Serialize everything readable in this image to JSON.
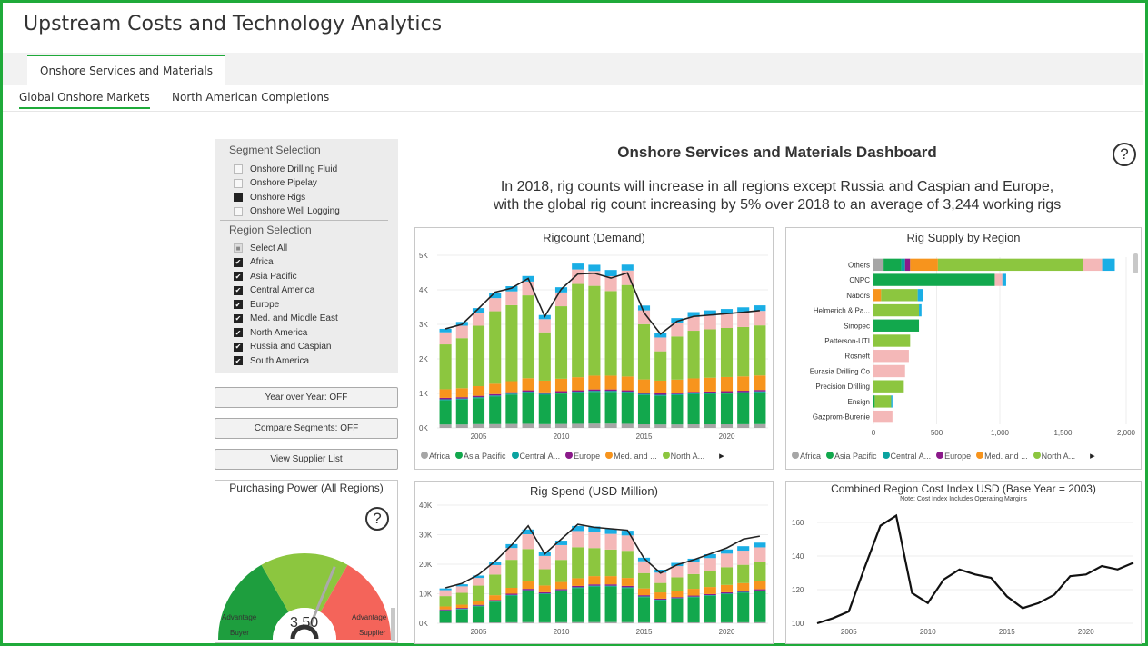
{
  "app": {
    "title": "Upstream Costs and Technology Analytics"
  },
  "tabs": {
    "main": "Onshore Services and Materials",
    "sub": [
      "Global Onshore Markets",
      "North American Completions"
    ]
  },
  "segment_selection": {
    "title": "Segment Selection",
    "items": [
      {
        "label": "Onshore Drilling Fluid",
        "checked": false
      },
      {
        "label": "Onshore Pipelay",
        "checked": false
      },
      {
        "label": "Onshore Rigs",
        "checked": true
      },
      {
        "label": "Onshore Well Logging",
        "checked": false
      }
    ]
  },
  "region_selection": {
    "title": "Region Selection",
    "items": [
      {
        "label": "Select All",
        "checked": "partial"
      },
      {
        "label": "Africa",
        "checked": true
      },
      {
        "label": "Asia Pacific",
        "checked": true
      },
      {
        "label": "Central America",
        "checked": true
      },
      {
        "label": "Europe",
        "checked": true
      },
      {
        "label": "Med. and Middle East",
        "checked": true
      },
      {
        "label": "North America",
        "checked": true
      },
      {
        "label": "Russia and Caspian",
        "checked": true
      },
      {
        "label": "South America",
        "checked": true
      }
    ]
  },
  "buttons": {
    "yoy": "Year over Year: OFF",
    "compare": "Compare Segments: OFF",
    "supplier": "View Supplier List"
  },
  "dashboard": {
    "title": "Onshore Services and Materials Dashboard",
    "headline_1": "In 2018, rig counts will increase in all regions except Russia and Caspian and Europe,",
    "headline_2": "with the global rig count increasing by 5% over 2018 to an average of 3,244 working rigs",
    "help_glyph": "?"
  },
  "colors": {
    "accent": "#1faa3a",
    "africa": "#a6a6a6",
    "asia_pacific": "#12a84d",
    "central_america": "#0aa3a0",
    "europe": "#8b1a8a",
    "med_me": "#f7941d",
    "north_america": "#8cc63f",
    "russia": "#f4b8b8",
    "south_america": "#1aaee5",
    "gauge_left": "#1e9e3e",
    "gauge_mid": "#8cc63f",
    "gauge_right": "#f4645a"
  },
  "legend": {
    "items": [
      "Africa",
      "Asia Pacific",
      "Central A...",
      "Europe",
      "Med. and ...",
      "North A..."
    ],
    "items_supply": [
      "Africa",
      "Asia Pacific",
      "Central A...",
      "Europe",
      "Med. and ...",
      "North A..."
    ],
    "next_icon": "play-right-icon"
  },
  "purchasing_power": {
    "title": "Purchasing Power (All Regions)",
    "value": "3.50",
    "value_num": 3.5,
    "left_label_1": "Advantage",
    "left_label_2": "Buyer",
    "right_label_1": "Advantage",
    "right_label_2": "Supplier"
  },
  "chart_data": [
    {
      "type": "bar",
      "id": "rigcount",
      "title": "Rigcount (Demand)",
      "stacked": true,
      "years": [
        2003,
        2004,
        2005,
        2006,
        2007,
        2008,
        2009,
        2010,
        2011,
        2012,
        2013,
        2014,
        2015,
        2016,
        2017,
        2018,
        2019,
        2020,
        2021,
        2022
      ],
      "ylim": [
        0,
        5000
      ],
      "yticks": [
        0,
        1000,
        2000,
        3000,
        4000,
        5000
      ],
      "ytick_labels": [
        "0K",
        "1K",
        "2K",
        "3K",
        "4K",
        "5K"
      ],
      "xticks": [
        2005,
        2010,
        2015,
        2020
      ],
      "series": [
        {
          "name": "Africa",
          "color": "#a6a6a6",
          "values": [
            100,
            100,
            110,
            110,
            115,
            120,
            110,
            115,
            120,
            125,
            125,
            120,
            105,
            100,
            100,
            105,
            105,
            105,
            108,
            110
          ]
        },
        {
          "name": "Asia Pacific",
          "color": "#12a84d",
          "values": [
            700,
            720,
            750,
            800,
            850,
            900,
            850,
            880,
            900,
            920,
            920,
            900,
            850,
            830,
            850,
            870,
            880,
            890,
            900,
            920
          ]
        },
        {
          "name": "Central America",
          "color": "#0aa3a0",
          "values": [
            30,
            30,
            30,
            30,
            30,
            30,
            30,
            30,
            30,
            30,
            30,
            30,
            30,
            30,
            30,
            30,
            30,
            30,
            30,
            30
          ]
        },
        {
          "name": "Europe",
          "color": "#8b1a8a",
          "values": [
            40,
            40,
            40,
            40,
            40,
            40,
            40,
            40,
            40,
            40,
            40,
            40,
            40,
            40,
            40,
            40,
            40,
            40,
            40,
            40
          ]
        },
        {
          "name": "Med. and Middle East",
          "color": "#f7941d",
          "values": [
            250,
            260,
            280,
            300,
            320,
            350,
            340,
            360,
            380,
            400,
            400,
            400,
            380,
            370,
            380,
            390,
            400,
            410,
            415,
            420
          ]
        },
        {
          "name": "North America",
          "color": "#8cc63f",
          "values": [
            1300,
            1450,
            1750,
            2100,
            2200,
            2400,
            1400,
            2100,
            2700,
            2600,
            2450,
            2650,
            1600,
            850,
            1250,
            1380,
            1400,
            1420,
            1430,
            1450
          ]
        },
        {
          "name": "Russia and Caspian",
          "color": "#f4b8b8",
          "values": [
            350,
            360,
            380,
            380,
            400,
            400,
            380,
            400,
            420,
            430,
            430,
            420,
            400,
            400,
            400,
            400,
            400,
            400,
            410,
            420
          ]
        },
        {
          "name": "South America",
          "color": "#1aaee5",
          "values": [
            100,
            110,
            130,
            150,
            150,
            160,
            120,
            150,
            170,
            180,
            180,
            170,
            140,
            120,
            130,
            140,
            150,
            150,
            160,
            160
          ]
        }
      ],
      "total_line": [
        2870,
        3000,
        3460,
        3930,
        4050,
        4330,
        3230,
        4020,
        4460,
        4480,
        4340,
        4490,
        3340,
        2720,
        3090,
        3230,
        3270,
        3310,
        3350,
        3400
      ]
    },
    {
      "type": "bar",
      "id": "rigsupply",
      "title": "Rig Supply by Region",
      "orientation": "horizontal",
      "stacked": true,
      "categories": [
        "Others",
        "CNPC",
        "Nabors",
        "Helmerich & Pa...",
        "Sinopec",
        "Patterson-UTI",
        "Rosneft",
        "Eurasia Drilling Co",
        "Precision Drilling",
        "Ensign",
        "Gazprom-Burenie"
      ],
      "xlim": [
        0,
        2000
      ],
      "xticks": [
        0,
        500,
        1000,
        1500,
        2000
      ],
      "xtick_labels": [
        "0",
        "500",
        "1,000",
        "1,500",
        "2,000"
      ],
      "series": [
        {
          "name": "Africa",
          "color": "#a6a6a6",
          "values": [
            80,
            0,
            0,
            0,
            0,
            0,
            0,
            0,
            0,
            0,
            0
          ]
        },
        {
          "name": "Asia Pacific",
          "color": "#12a84d",
          "values": [
            140,
            960,
            0,
            0,
            360,
            0,
            0,
            0,
            0,
            10,
            0
          ]
        },
        {
          "name": "Central America",
          "color": "#0aa3a0",
          "values": [
            30,
            0,
            0,
            0,
            0,
            0,
            0,
            0,
            0,
            0,
            0
          ]
        },
        {
          "name": "Europe",
          "color": "#8b1a8a",
          "values": [
            40,
            0,
            0,
            0,
            0,
            0,
            0,
            0,
            0,
            0,
            0
          ]
        },
        {
          "name": "Med. and Middle East",
          "color": "#f7941d",
          "values": [
            220,
            0,
            60,
            0,
            0,
            0,
            0,
            0,
            0,
            0,
            0
          ]
        },
        {
          "name": "North America",
          "color": "#8cc63f",
          "values": [
            1150,
            0,
            290,
            360,
            0,
            290,
            0,
            0,
            240,
            130,
            0
          ]
        },
        {
          "name": "Russia and Caspian",
          "color": "#f4b8b8",
          "values": [
            150,
            60,
            0,
            0,
            0,
            0,
            280,
            250,
            0,
            0,
            150
          ]
        },
        {
          "name": "South America",
          "color": "#1aaee5",
          "values": [
            100,
            30,
            40,
            20,
            0,
            0,
            0,
            0,
            0,
            10,
            0
          ]
        }
      ]
    },
    {
      "type": "bar",
      "id": "rigspend",
      "title": "Rig Spend (USD Million)",
      "stacked": true,
      "years": [
        2003,
        2004,
        2005,
        2006,
        2007,
        2008,
        2009,
        2010,
        2011,
        2012,
        2013,
        2014,
        2015,
        2016,
        2017,
        2018,
        2019,
        2020,
        2021,
        2022
      ],
      "ylim": [
        0,
        40000
      ],
      "yticks": [
        0,
        10000,
        20000,
        30000,
        40000
      ],
      "ytick_labels": [
        "0K",
        "10K",
        "20K",
        "30K",
        "40K"
      ],
      "xticks": [
        2005,
        2010,
        2015,
        2020
      ],
      "series": [
        {
          "name": "Africa",
          "color": "#a6a6a6",
          "values": [
            200,
            200,
            250,
            300,
            350,
            400,
            350,
            380,
            400,
            420,
            420,
            400,
            350,
            300,
            310,
            320,
            330,
            340,
            350,
            360
          ]
        },
        {
          "name": "Asia Pacific",
          "color": "#12a84d",
          "values": [
            4000,
            4500,
            5500,
            7000,
            9000,
            10500,
            9500,
            10500,
            11500,
            12000,
            12000,
            11500,
            8500,
            7500,
            8000,
            8500,
            9000,
            9500,
            10000,
            10500
          ]
        },
        {
          "name": "Central America",
          "color": "#0aa3a0",
          "values": [
            200,
            200,
            200,
            250,
            250,
            300,
            250,
            300,
            300,
            300,
            300,
            300,
            250,
            200,
            200,
            200,
            200,
            250,
            250,
            250
          ]
        },
        {
          "name": "Europe",
          "color": "#8b1a8a",
          "values": [
            300,
            300,
            300,
            350,
            400,
            450,
            400,
            400,
            450,
            450,
            450,
            450,
            400,
            350,
            350,
            350,
            350,
            400,
            400,
            400
          ]
        },
        {
          "name": "Med. and Middle East",
          "color": "#f7941d",
          "values": [
            1000,
            1100,
            1300,
            1600,
            2000,
            2500,
            2300,
            2400,
            2600,
            2800,
            2800,
            2700,
            2300,
            2100,
            2200,
            2300,
            2400,
            2500,
            2600,
            2700
          ]
        },
        {
          "name": "North America",
          "color": "#8cc63f",
          "values": [
            3500,
            4000,
            5200,
            7000,
            9500,
            11000,
            5500,
            7500,
            10500,
            9500,
            9000,
            9200,
            5200,
            3200,
            4500,
            5000,
            5500,
            6000,
            6200,
            6500
          ]
        },
        {
          "name": "Russia and Caspian",
          "color": "#f4b8b8",
          "values": [
            2000,
            2200,
            2600,
            3200,
            4000,
            5000,
            4500,
            5000,
            5500,
            5500,
            5300,
            5200,
            4000,
            3500,
            3800,
            4000,
            4300,
            4600,
            4800,
            5000
          ]
        },
        {
          "name": "South America",
          "color": "#1aaee5",
          "values": [
            600,
            700,
            800,
            1000,
            1300,
            1600,
            1200,
            1500,
            1700,
            1800,
            1700,
            1600,
            1200,
            1000,
            1100,
            1200,
            1300,
            1400,
            1500,
            1600
          ]
        }
      ],
      "total_line": [
        12000,
        13500,
        16500,
        21000,
        26500,
        33000,
        23500,
        28500,
        33500,
        32500,
        32000,
        31500,
        22000,
        17000,
        19800,
        21500,
        23500,
        25500,
        28500,
        29500
      ]
    },
    {
      "type": "line",
      "id": "costindex",
      "title": "Combined Region Cost Index USD (Base Year = 2003)",
      "subtitle": "Note: Cost Index Includes Operating Margins",
      "x": [
        2003,
        2004,
        2005,
        2006,
        2007,
        2008,
        2009,
        2010,
        2011,
        2012,
        2013,
        2014,
        2015,
        2016,
        2017,
        2018,
        2019,
        2020,
        2021,
        2022,
        2023
      ],
      "y": [
        100,
        103,
        107,
        133,
        158,
        164,
        118,
        112,
        126,
        132,
        129,
        127,
        116,
        109,
        112,
        117,
        128,
        129,
        134,
        132,
        136
      ],
      "ylim": [
        100,
        167
      ],
      "yticks": [
        100,
        120,
        140,
        160
      ],
      "xticks": [
        2005,
        2010,
        2015,
        2020
      ]
    }
  ]
}
